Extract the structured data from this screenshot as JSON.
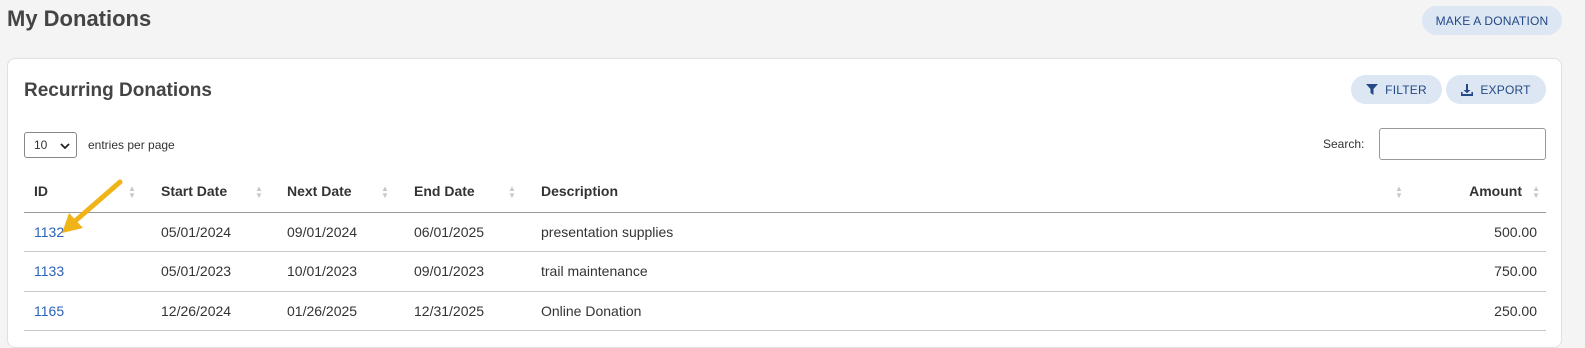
{
  "page": {
    "title": "My Donations"
  },
  "header": {
    "make_donation_label": "MAKE A DONATION"
  },
  "card": {
    "title": "Recurring Donations",
    "filter_label": "FILTER",
    "export_label": "EXPORT",
    "entries_value": "10",
    "entries_label": "entries per page",
    "search_label": "Search:",
    "search_value": ""
  },
  "table": {
    "columns": [
      "ID",
      "Start Date",
      "Next Date",
      "End Date",
      "Description",
      "Amount"
    ],
    "rows": [
      {
        "id": "1132",
        "start": "05/01/2024",
        "next": "09/01/2024",
        "end": "06/01/2025",
        "description": "presentation supplies",
        "amount": "500.00"
      },
      {
        "id": "1133",
        "start": "05/01/2023",
        "next": "10/01/2023",
        "end": "09/01/2023",
        "description": "trail maintenance",
        "amount": "750.00"
      },
      {
        "id": "1165",
        "start": "12/26/2024",
        "next": "01/26/2025",
        "end": "12/31/2025",
        "description": "Online Donation",
        "amount": "250.00"
      }
    ]
  },
  "colors": {
    "accent": "#2a62b8",
    "button_bg": "#dde6f3",
    "annotation_arrow": "#f0b419"
  },
  "icons": {
    "filter": "filter-icon",
    "export": "download-icon",
    "sort": "sort-icon",
    "annotation": "arrow-annotation-icon"
  }
}
